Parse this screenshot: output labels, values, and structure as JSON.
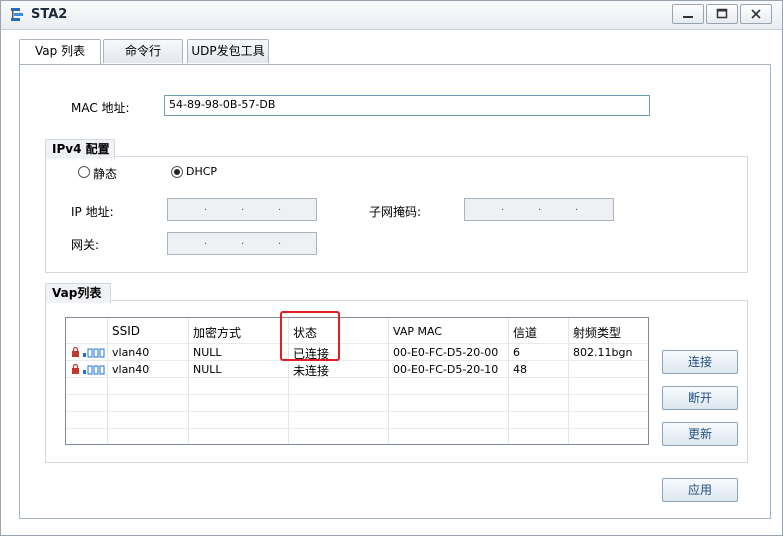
{
  "window": {
    "title": "STA2"
  },
  "tabs": [
    {
      "label": "Vap 列表",
      "active": true
    },
    {
      "label": "命令行",
      "active": false
    },
    {
      "label": "UDP发包工具",
      "active": false
    }
  ],
  "mac": {
    "label": "MAC 地址:",
    "value": "54-89-98-0B-57-DB"
  },
  "ipv4": {
    "title": "IPv4 配置",
    "static_label": "静态",
    "dhcp_label": "DHCP",
    "mode": "dhcp",
    "ip_label": "IP 地址:",
    "mask_label": "子网掩码:",
    "gateway_label": "网关:",
    "ip_dots": ".",
    "mask_dots": ".",
    "gateway_dots": "."
  },
  "vap": {
    "title": "Vap列表",
    "columns": [
      "SSID",
      "加密方式",
      "状态",
      "VAP MAC",
      "信道",
      "射频类型"
    ],
    "rows": [
      {
        "ssid": "vlan40",
        "enc": "NULL",
        "status": "已连接",
        "mac": "00-E0-FC-D5-20-00",
        "channel": "6",
        "radio": "802.11bgn"
      },
      {
        "ssid": "vlan40",
        "enc": "NULL",
        "status": "未连接",
        "mac": "00-E0-FC-D5-20-10",
        "channel": "48",
        "radio": ""
      }
    ],
    "buttons": {
      "connect": "连接",
      "disconnect": "断开",
      "refresh": "更新"
    }
  },
  "apply_label": "应用",
  "icons": {
    "app": "network-icon",
    "lock": "lock-icon",
    "signal": "signal-bars-icon"
  },
  "colors": {
    "highlight": "#e02020",
    "lock": "#c0392b",
    "signal": "#1e6fd9"
  }
}
